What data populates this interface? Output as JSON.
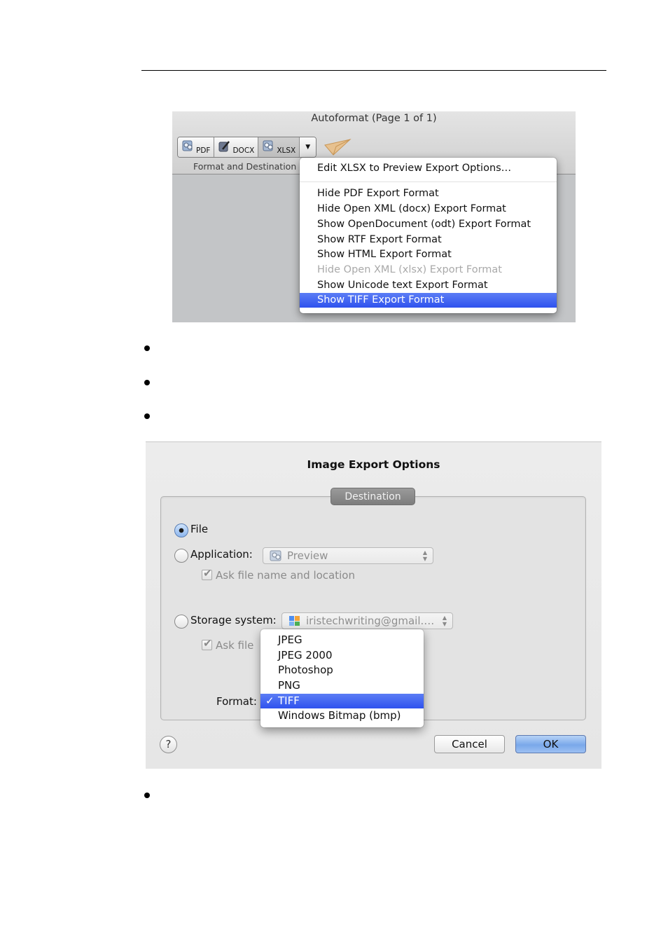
{
  "autoformat": {
    "window_title": "Autoformat (Page 1 of 1)",
    "format_buttons": [
      {
        "label": "PDF",
        "icon": "pdf-format-icon",
        "active": false
      },
      {
        "label": "DOCX",
        "icon": "docx-format-icon",
        "active": false
      },
      {
        "label": "XLSX",
        "icon": "xlsx-format-icon",
        "active": true
      }
    ],
    "dropdown_glyph": "▼",
    "send_icon": "paper-plane-icon",
    "group_label": "Format and Destination",
    "menu": {
      "header_item": "Edit XLSX to Preview Export Options…",
      "items": [
        {
          "label": "Hide PDF Export Format",
          "state": "enabled"
        },
        {
          "label": "Hide Open XML (docx) Export Format",
          "state": "enabled"
        },
        {
          "label": "Show OpenDocument (odt) Export Format",
          "state": "enabled"
        },
        {
          "label": "Show RTF Export Format",
          "state": "enabled"
        },
        {
          "label": "Show HTML Export Format",
          "state": "enabled"
        },
        {
          "label": "Hide Open XML (xlsx) Export Format",
          "state": "disabled"
        },
        {
          "label": "Show Unicode text Export Format",
          "state": "enabled"
        },
        {
          "label": "Show TIFF Export Format",
          "state": "selected"
        }
      ]
    }
  },
  "image_export": {
    "title": "Image Export Options",
    "section_tab": "Destination",
    "file_label": "File",
    "application_label": "Application:",
    "application_value": "Preview",
    "ask_file_label": "Ask file name and location",
    "storage_label": "Storage system:",
    "storage_value": "iristechwriting@gmail.…",
    "ask_file_partial": "Ask file",
    "format_label": "Format:",
    "selected_destination": "File",
    "format_options": [
      {
        "label": "JPEG",
        "selected": false
      },
      {
        "label": "JPEG 2000",
        "selected": false
      },
      {
        "label": "Photoshop",
        "selected": false
      },
      {
        "label": "PNG",
        "selected": false
      },
      {
        "label": "TIFF",
        "selected": true
      },
      {
        "label": "Windows Bitmap (bmp)",
        "selected": false
      }
    ],
    "check_glyph": "✓",
    "help_label": "?",
    "cancel_label": "Cancel",
    "ok_label": "OK",
    "accent_color": "#3a5df0"
  }
}
